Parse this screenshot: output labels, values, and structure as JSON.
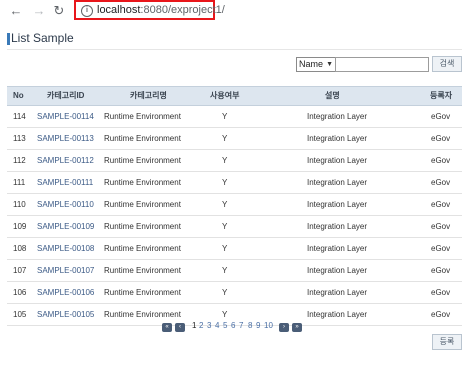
{
  "browser": {
    "url_host": "localhost",
    "url_path": ":8080/exproject1/",
    "back_glyph": "←",
    "forward_glyph": "→",
    "reload_glyph": "↻"
  },
  "page": {
    "title": "List Sample"
  },
  "search": {
    "select_value": "Name",
    "input_value": "",
    "button_label": "검색"
  },
  "table": {
    "headers": [
      "No",
      "카테고리ID",
      "카테고리명",
      "사용여부",
      "설명",
      "등록자"
    ],
    "rows": [
      {
        "no": "114",
        "id": "SAMPLE-00114",
        "name": "Runtime Environment",
        "use": "Y",
        "desc": "Integration Layer",
        "reg": "eGov"
      },
      {
        "no": "113",
        "id": "SAMPLE-00113",
        "name": "Runtime Environment",
        "use": "Y",
        "desc": "Integration Layer",
        "reg": "eGov"
      },
      {
        "no": "112",
        "id": "SAMPLE-00112",
        "name": "Runtime Environment",
        "use": "Y",
        "desc": "Integration Layer",
        "reg": "eGov"
      },
      {
        "no": "111",
        "id": "SAMPLE-00111",
        "name": "Runtime Environment",
        "use": "Y",
        "desc": "Integration Layer",
        "reg": "eGov"
      },
      {
        "no": "110",
        "id": "SAMPLE-00110",
        "name": "Runtime Environment",
        "use": "Y",
        "desc": "Integration Layer",
        "reg": "eGov"
      },
      {
        "no": "109",
        "id": "SAMPLE-00109",
        "name": "Runtime Environment",
        "use": "Y",
        "desc": "Integration Layer",
        "reg": "eGov"
      },
      {
        "no": "108",
        "id": "SAMPLE-00108",
        "name": "Runtime Environment",
        "use": "Y",
        "desc": "Integration Layer",
        "reg": "eGov"
      },
      {
        "no": "107",
        "id": "SAMPLE-00107",
        "name": "Runtime Environment",
        "use": "Y",
        "desc": "Integration Layer",
        "reg": "eGov"
      },
      {
        "no": "106",
        "id": "SAMPLE-00106",
        "name": "Runtime Environment",
        "use": "Y",
        "desc": "Integration Layer",
        "reg": "eGov"
      },
      {
        "no": "105",
        "id": "SAMPLE-00105",
        "name": "Runtime Environment",
        "use": "Y",
        "desc": "Integration Layer",
        "reg": "eGov"
      }
    ]
  },
  "pagination": {
    "pages": [
      "1",
      "2",
      "3",
      "4",
      "5",
      "6",
      "7",
      "8",
      "9",
      "10"
    ],
    "current": "1",
    "first_glyph": "«",
    "prev_glyph": "‹",
    "next_glyph": "›",
    "last_glyph": "»"
  },
  "actions": {
    "register_label": "등록"
  },
  "colors": {
    "url_highlight": "#e8161b",
    "header_bg": "#dde6ef",
    "link": "#3b5a86"
  }
}
